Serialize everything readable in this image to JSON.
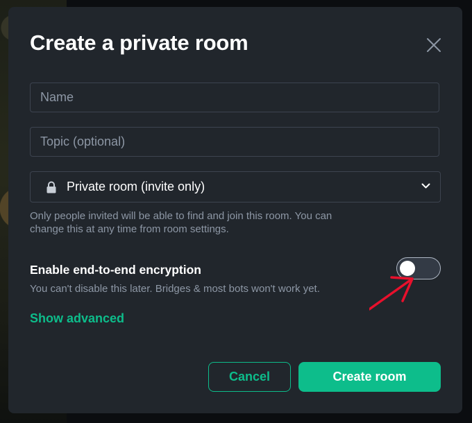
{
  "dialog": {
    "title": "Create a private room"
  },
  "fields": {
    "name_placeholder": "Name",
    "name_value": "",
    "topic_placeholder": "Topic (optional)",
    "topic_value": ""
  },
  "visibility": {
    "selected": "Private room (invite only)",
    "icon": "lock-icon",
    "helper": "Only people invited will be able to find and join this room. You can change this at any time from room settings."
  },
  "encryption": {
    "label": "Enable end-to-end encryption",
    "description": "You can't disable this later. Bridges & most bots won't work yet.",
    "enabled": false
  },
  "advanced_link": "Show advanced",
  "buttons": {
    "cancel": "Cancel",
    "create": "Create room"
  },
  "colors": {
    "accent": "#0dbd8b",
    "dialog_bg": "#21262c",
    "annotation_arrow": "#e8102c"
  }
}
